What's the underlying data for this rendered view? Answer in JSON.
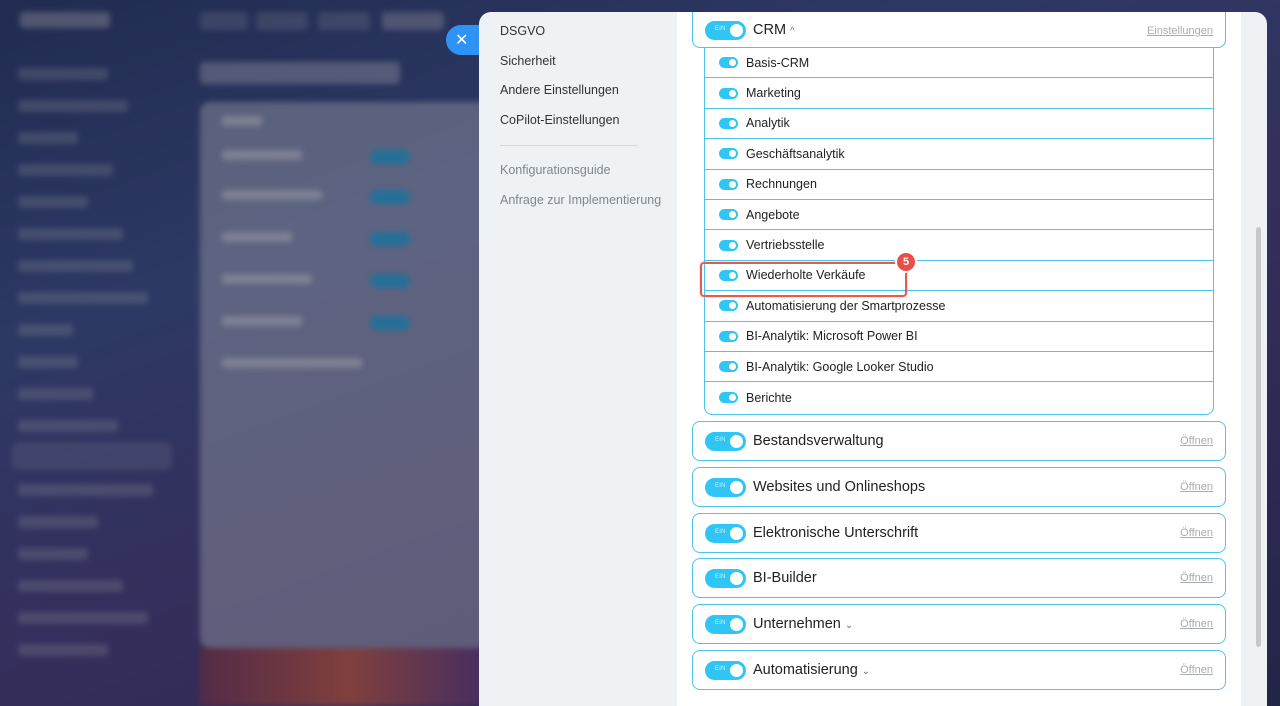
{
  "nav": {
    "items": [
      "DSGVO",
      "Sicherheit",
      "Andere Einstellungen",
      "CoPilot-Einstellungen"
    ],
    "secondary": [
      "Konfigurationsguide",
      "Anfrage zur Implementierung"
    ]
  },
  "toggle_text": "EIN",
  "crm": {
    "title": "CRM",
    "link": "Einstellungen",
    "items": [
      "Basis-CRM",
      "Marketing",
      "Analytik",
      "Geschäftsanalytik",
      "Rechnungen",
      "Angebote",
      "Vertriebsstelle",
      "Wiederholte Verkäufe",
      "Automatisierung der Smartprozesse",
      "BI-Analytik: Microsoft Power BI",
      "BI-Analytik: Google Looker Studio",
      "Berichte"
    ]
  },
  "groups": [
    {
      "title": "Bestandsverwaltung",
      "link": "Öffnen",
      "has_chevron": false
    },
    {
      "title": "Websites und Onlineshops",
      "link": "Öffnen",
      "has_chevron": false
    },
    {
      "title": "Elektronische Unterschrift",
      "link": "Öffnen",
      "has_chevron": false
    },
    {
      "title": "BI-Builder",
      "link": "Öffnen",
      "has_chevron": false
    },
    {
      "title": "Unternehmen",
      "link": "Öffnen",
      "has_chevron": true
    },
    {
      "title": "Automatisierung",
      "link": "Öffnen",
      "has_chevron": true
    }
  ],
  "highlight": {
    "step_number": "5",
    "item_index": 7
  },
  "colors": {
    "accent": "#2fc6f6",
    "border": "#4cc3e8",
    "highlight": "#e85a4f",
    "close": "#2f93f5"
  }
}
